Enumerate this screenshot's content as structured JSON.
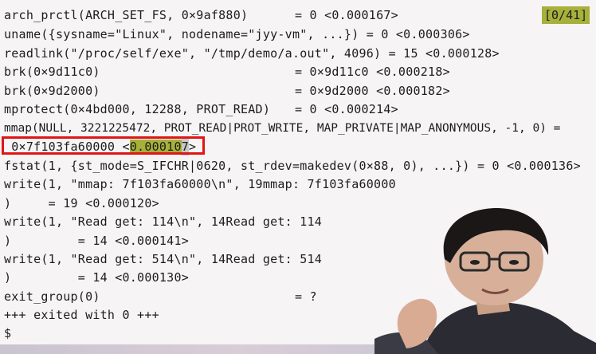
{
  "terminal": {
    "counter": "[0/41]",
    "lines": [
      {
        "left": "arch_prctl(ARCH_SET_FS, 0×9af880)",
        "right": "= 0 <0.000167>"
      },
      {
        "left": "uname({sysname=\"Linux\", nodename=\"jyy-vm\", ...}) = 0 <0.000306>",
        "right": ""
      },
      {
        "left": "readlink(\"/proc/self/exe\", \"/tmp/demo/a.out\", 4096) = 15 <0.000128>",
        "right": ""
      },
      {
        "left": "brk(0×9d11c0)",
        "right": "= 0×9d11c0 <0.000218>"
      },
      {
        "left": "brk(0×9d2000)",
        "right": "= 0×9d2000 <0.000182>"
      },
      {
        "left": "mprotect(0×4bd000, 12288, PROT_READ)",
        "right": "= 0 <0.000214>"
      },
      {
        "left": "mmap(NULL, 3221225472, PROT_READ|PROT_WRITE, MAP_PRIVATE|MAP_ANONYMOUS, -1, 0) =",
        "right": ""
      },
      {
        "left": "",
        "right": ""
      },
      {
        "left": "fstat(1, {st_mode=S_IFCHR|0620, st_rdev=makedev(0×88, 0), ...}) = 0 <0.000136>",
        "right": ""
      },
      {
        "left": "write(1, \"mmap: 7f103fa60000\\n\", 19mmap: 7f103fa60000",
        "right": ""
      },
      {
        "left": ")     = 19 <0.000120>",
        "right": ""
      },
      {
        "left": "write(1, \"Read get: 114\\n\", 14Read get: 114",
        "right": ""
      },
      {
        "left": ")         = 14 <0.000141>",
        "right": ""
      },
      {
        "left": "write(1, \"Read get: 514\\n\", 14Read get: 514",
        "right": ""
      },
      {
        "left": ")         = 14 <0.000130>",
        "right": ""
      },
      {
        "left": "exit_group(0)",
        "right": "= ?"
      },
      {
        "left": "+++ exited with 0 +++",
        "right": ""
      },
      {
        "left": "$",
        "right": ""
      }
    ],
    "mmap_result": {
      "prefix": " 0×7f103fa60000 <",
      "highlight": "0.00010",
      "cursor": "7",
      "suffix": ">"
    }
  },
  "colors": {
    "highlight": "#a6b03a",
    "annotation_box": "#e21414"
  }
}
